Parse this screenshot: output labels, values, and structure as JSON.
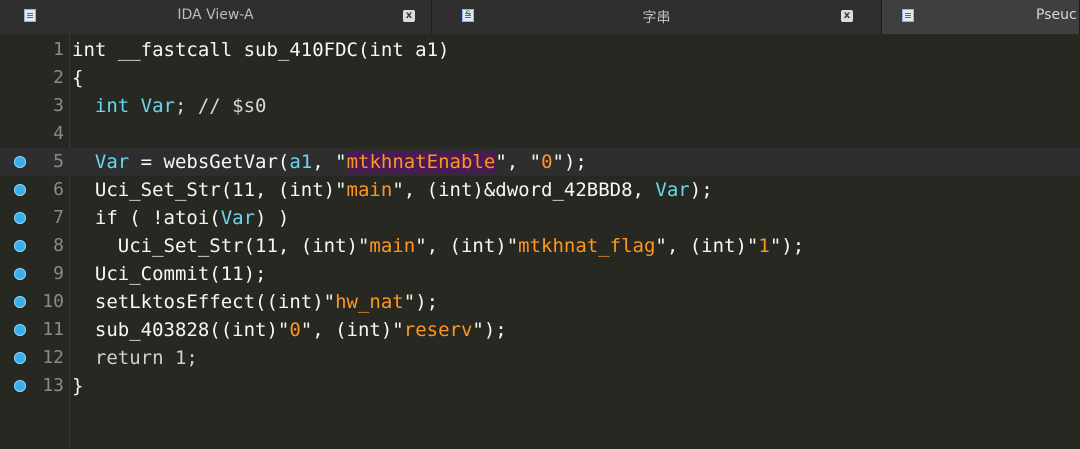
{
  "tabs": [
    {
      "title": "IDA View-A",
      "icon": "disassembly-view-icon"
    },
    {
      "title": "字串",
      "icon": "strings-view-icon"
    },
    {
      "title": "Pseuc",
      "icon": "pseudocode-view-icon"
    }
  ],
  "close_label": "x",
  "colors": {
    "background": "#272822",
    "keyword": "#f8f8f2",
    "type": "#66d9ef",
    "string": "#fd971f",
    "breakpoint": "#3aaee8",
    "highlight": "#4a1a55"
  },
  "code": {
    "lines": [
      {
        "num": "1",
        "bp": false,
        "tokens": [
          {
            "t": "int __fastcall sub_410FDC(int a1)",
            "c": "white"
          }
        ]
      },
      {
        "num": "2",
        "bp": false,
        "tokens": [
          {
            "t": "{",
            "c": "white"
          }
        ]
      },
      {
        "num": "3",
        "bp": false,
        "tokens": [
          {
            "t": "  ",
            "c": "white"
          },
          {
            "t": "int Var",
            "c": "cyan"
          },
          {
            "t": "; // $s0",
            "c": "com"
          }
        ]
      },
      {
        "num": "4",
        "bp": false,
        "tokens": []
      },
      {
        "num": "5",
        "bp": true,
        "current": true,
        "tokens": [
          {
            "t": "  ",
            "c": "white"
          },
          {
            "t": "Var",
            "c": "cyan"
          },
          {
            "t": " = websGetVar(",
            "c": "white"
          },
          {
            "t": "a1",
            "c": "cyan"
          },
          {
            "t": ", \"",
            "c": "white"
          },
          {
            "t": "mtkhnatEnable",
            "c": "str",
            "hl": true
          },
          {
            "t": "\", \"",
            "c": "white"
          },
          {
            "t": "0",
            "c": "str"
          },
          {
            "t": "\");",
            "c": "white"
          }
        ]
      },
      {
        "num": "6",
        "bp": true,
        "tokens": [
          {
            "t": "  Uci_Set_Str(11, (int)\"",
            "c": "white"
          },
          {
            "t": "main",
            "c": "str"
          },
          {
            "t": "\", (int)&dword_42BBD8, ",
            "c": "white"
          },
          {
            "t": "Var",
            "c": "cyan"
          },
          {
            "t": ");",
            "c": "white"
          }
        ]
      },
      {
        "num": "7",
        "bp": true,
        "tokens": [
          {
            "t": "  if ( !atoi(",
            "c": "white"
          },
          {
            "t": "Var",
            "c": "cyan"
          },
          {
            "t": ") )",
            "c": "white"
          }
        ]
      },
      {
        "num": "8",
        "bp": true,
        "tokens": [
          {
            "t": "    Uci_Set_Str(11, (int)\"",
            "c": "white"
          },
          {
            "t": "main",
            "c": "str"
          },
          {
            "t": "\", (int)\"",
            "c": "white"
          },
          {
            "t": "mtkhnat_flag",
            "c": "str"
          },
          {
            "t": "\", (int)\"",
            "c": "white"
          },
          {
            "t": "1",
            "c": "str"
          },
          {
            "t": "\");",
            "c": "white"
          }
        ]
      },
      {
        "num": "9",
        "bp": true,
        "tokens": [
          {
            "t": "  Uci_Commit(11);",
            "c": "white"
          }
        ]
      },
      {
        "num": "10",
        "bp": true,
        "tokens": [
          {
            "t": "  setLktosEffect((int)\"",
            "c": "white"
          },
          {
            "t": "hw_nat",
            "c": "str"
          },
          {
            "t": "\");",
            "c": "white"
          }
        ]
      },
      {
        "num": "11",
        "bp": true,
        "tokens": [
          {
            "t": "  sub_403828((int)\"",
            "c": "white"
          },
          {
            "t": "0",
            "c": "str"
          },
          {
            "t": "\", (int)\"",
            "c": "white"
          },
          {
            "t": "reserv",
            "c": "str"
          },
          {
            "t": "\");",
            "c": "white"
          }
        ]
      },
      {
        "num": "12",
        "bp": true,
        "tokens": [
          {
            "t": "  return 1;",
            "c": "gray"
          }
        ]
      },
      {
        "num": "13",
        "bp": true,
        "tokens": [
          {
            "t": "}",
            "c": "white"
          }
        ]
      }
    ]
  }
}
